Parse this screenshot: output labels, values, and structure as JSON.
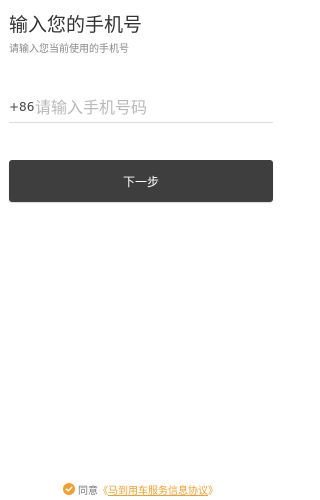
{
  "header": {
    "title": "输入您的手机号",
    "subtitle": "请输入您当前使用的手机号"
  },
  "phone": {
    "country_code": "+86",
    "placeholder": "请输入手机号码",
    "value": ""
  },
  "actions": {
    "next_label": "下一步"
  },
  "agreement": {
    "checked": true,
    "prefix": "同意",
    "link_open": "《",
    "link_text": "马到用车服务信息协议",
    "link_close": "》",
    "check_icon": "check-circle-icon"
  },
  "colors": {
    "accent": "#f0a030",
    "button_bg": "#3e3e3e",
    "text_primary": "#333333",
    "text_secondary": "#888888",
    "placeholder": "#b9b9b9",
    "divider": "#dcdcdc"
  }
}
